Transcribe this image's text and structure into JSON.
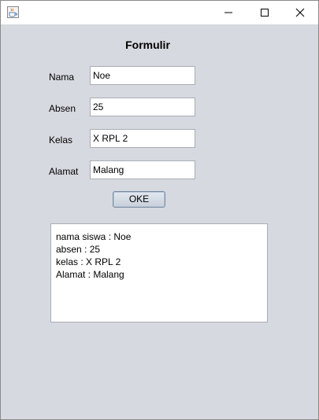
{
  "window": {
    "icon": "java-coffee-cup-icon",
    "controls": [
      "minimize-icon",
      "maximize-icon",
      "close-icon"
    ]
  },
  "form": {
    "title": "Formulir",
    "fields": [
      {
        "label": "Nama",
        "value": "Noe"
      },
      {
        "label": "Absen",
        "value": "25"
      },
      {
        "label": "Kelas",
        "value": "X RPL 2"
      },
      {
        "label": "Alamat",
        "value": "Malang"
      }
    ],
    "submit_label": "OKE"
  },
  "output": {
    "lines": [
      "nama siswa : Noe",
      "absen : 25",
      "kelas : X RPL 2",
      "Alamat : Malang"
    ]
  },
  "colors": {
    "panel_bg": "#d6d9df",
    "field_border": "#a9adb5",
    "button_border": "#7a8aa0"
  }
}
